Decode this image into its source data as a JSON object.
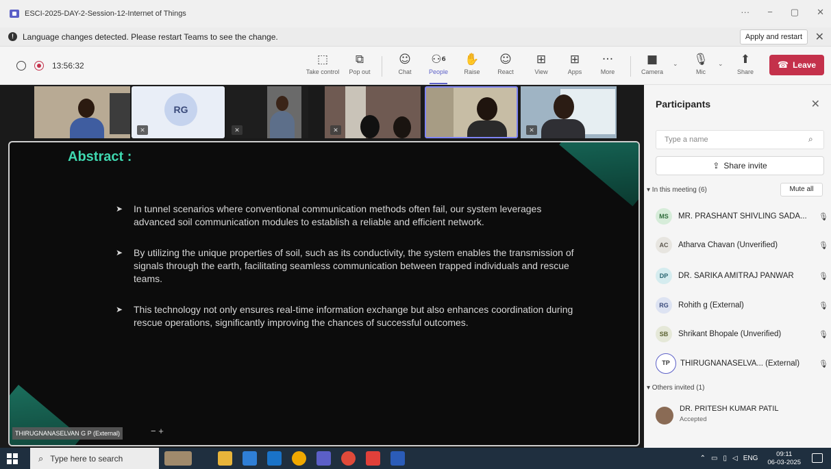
{
  "window": {
    "title": "ESCI-2025-DAY-2-Session-12-Internet of Things",
    "controls": [
      "···",
      "−",
      "▢",
      "✕"
    ]
  },
  "notice": {
    "message": "Language changes detected. Please restart Teams to see the change.",
    "apply_label": "Apply and restart",
    "close": "✕"
  },
  "toolbar": {
    "timer": "13:56:32",
    "buttons": [
      {
        "label": "Take control",
        "icon": "⬚"
      },
      {
        "label": "Pop out",
        "icon": "⧉"
      },
      {
        "label": "Chat",
        "icon": "☺"
      },
      {
        "label": "People",
        "icon": "⚇",
        "count": "6"
      },
      {
        "label": "Raise",
        "icon": "✋"
      },
      {
        "label": "React",
        "icon": "☺"
      },
      {
        "label": "View",
        "icon": "⊞"
      },
      {
        "label": "Apps",
        "icon": "⊞"
      },
      {
        "label": "More",
        "icon": "···"
      },
      {
        "label": "Camera",
        "icon": "■"
      },
      {
        "label": "Mic",
        "icon": "🎙"
      },
      {
        "label": "Share",
        "icon": "⬆"
      }
    ],
    "leave_label": "Leave"
  },
  "gallery": {
    "rg_initials": "RG"
  },
  "slide": {
    "title": "Abstract :",
    "bullets": [
      "In tunnel  scenarios where conventional communication methods often fail, our system leverages advanced soil communication modules to establish a reliable and efficient network.",
      "By utilizing the unique properties of soil, such as its conductivity, the system enables the transmission of signals through the earth, facilitating seamless communication between trapped individuals and rescue teams.",
      "This technology not only ensures real-time information exchange but also enhances coordination during rescue operations, significantly improving the chances  of successful outcomes."
    ],
    "presenter": "THIRUGNANASELVAN G P (External)",
    "presenter_controls": "−   +"
  },
  "participants": {
    "title": "Participants",
    "search_placeholder": "Type a name",
    "share_invite": "Share invite",
    "in_meeting_label": "▾ In this meeting (6)",
    "mute_all": "Mute all",
    "people": [
      {
        "initials": "MS",
        "name": "MR. PRASHANT SHIVLING SADA...",
        "color": "#d6ecd9",
        "fg": "#2e6b3a",
        "mic": "🎙"
      },
      {
        "initials": "AC",
        "name": "Atharva Chavan (Unverified)",
        "color": "#e7e5e0",
        "fg": "#5b564d",
        "mic": "🎙"
      },
      {
        "initials": "DP",
        "name": "DR. SARIKA AMITRAJ PANWAR",
        "color": "#d5ecef",
        "fg": "#2a6670",
        "mic": "🎙"
      },
      {
        "initials": "RG",
        "name": "Rohith g (External)",
        "color": "#dde3f2",
        "fg": "#3a4a7a",
        "mic": "🎙"
      },
      {
        "initials": "SB",
        "name": "Shrikant Bhopale (Unverified)",
        "color": "#e5e8d8",
        "fg": "#5a6130",
        "mic": "🎙"
      },
      {
        "initials": "TP",
        "name": "THIRUGNANASELVA...  (External)",
        "color": "#ffffff",
        "fg": "#333333",
        "mic": "🎙"
      }
    ],
    "others_label": "▾ Others invited (1)",
    "invited": {
      "name": "DR. PRITESH KUMAR PATIL",
      "status": "Accepted"
    }
  },
  "taskbar": {
    "search_placeholder": "Type here to search",
    "tray": {
      "lang": "ENG",
      "time": "09:11",
      "date": "06-03-2025"
    }
  },
  "colors": {
    "accent": "#5b5fc7",
    "leave": "#c4314b",
    "slide_title": "#3fd8b0"
  }
}
